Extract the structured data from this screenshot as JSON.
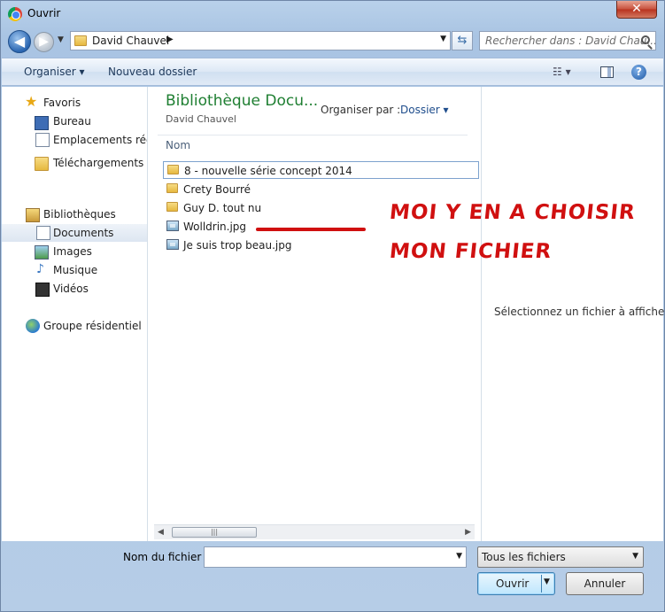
{
  "window": {
    "title": "Ouvrir",
    "close_glyph": "✕"
  },
  "nav": {
    "back_glyph": "◀",
    "forward_glyph": "▶",
    "address": "David Chauvel",
    "search_placeholder": "Rechercher dans : David Chau..."
  },
  "toolbar": {
    "organise_label": "Organiser ▾",
    "new_folder_label": "Nouveau dossier",
    "view_label": "☷ ▾",
    "help_label": "?"
  },
  "sidebar": {
    "favorites": "Favoris",
    "items": [
      {
        "label": "Bureau",
        "icon": "desktop-icon"
      },
      {
        "label": "Emplacements récents",
        "icon": "recent-places-icon"
      },
      {
        "label": "Téléchargements",
        "icon": "downloads-folder-icon"
      }
    ],
    "libraries": "Bibliothèques",
    "library_items": [
      {
        "label": "Documents",
        "icon": "documents-icon",
        "selected": true
      },
      {
        "label": "Images",
        "icon": "images-icon"
      },
      {
        "label": "Musique",
        "icon": "music-icon"
      },
      {
        "label": "Vidéos",
        "icon": "videos-icon"
      }
    ],
    "homegroup": "Groupe résidentiel"
  },
  "filepane": {
    "library_title": "Bibliothèque Docu...",
    "library_subtitle": "David Chauvel",
    "arrange_label": "Organiser par :",
    "arrange_value": "Dossier ▾",
    "column_name": "Nom",
    "items": [
      {
        "name": "8 - nouvelle série concept 2014",
        "type": "folder"
      },
      {
        "name": "Crety Bourré",
        "type": "folder"
      },
      {
        "name": "Guy D. tout nu",
        "type": "folder"
      },
      {
        "name": "Wolldrin.jpg",
        "type": "image"
      },
      {
        "name": "Je suis trop beau.jpg",
        "type": "image"
      }
    ]
  },
  "preview": {
    "empty_text": "Sélectionnez un fichier à afficher."
  },
  "annotation": {
    "line1": "MOI Y EN A CHOISIR",
    "line2": "MON FICHIER",
    "color": "#d01010"
  },
  "footer": {
    "filename_label": "Nom du fichier :",
    "filename_value": "",
    "filter_value": "Tous les fichiers",
    "open_label": "Ouvrir",
    "cancel_label": "Annuler"
  }
}
